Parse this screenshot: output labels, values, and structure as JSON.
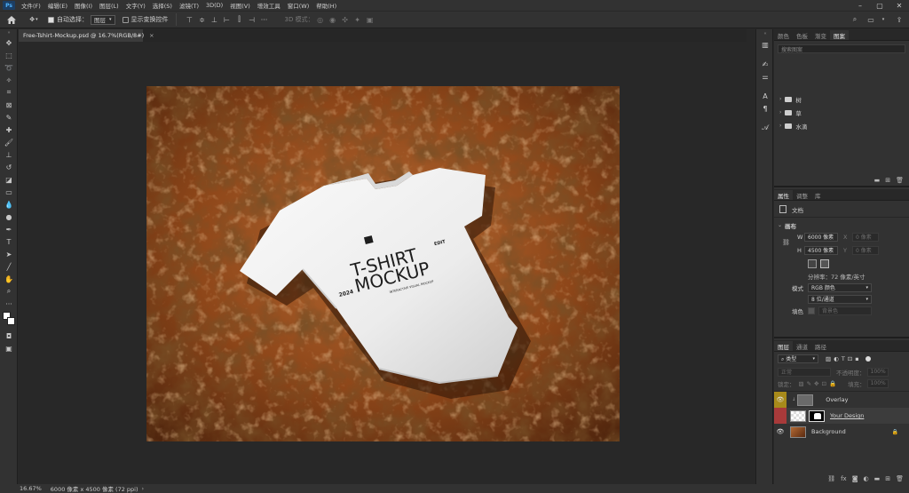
{
  "menu": [
    "文件(F)",
    "编辑(E)",
    "图像(I)",
    "图层(L)",
    "文字(Y)",
    "选择(S)",
    "滤镜(T)",
    "3D(D)",
    "视图(V)",
    "增效工具",
    "窗口(W)",
    "帮助(H)"
  ],
  "options": {
    "auto_select_label": "自动选择：",
    "auto_select_value": "图层",
    "show_transform_label": "显示变换控件",
    "mode_3d_label": "3D 模式："
  },
  "document": {
    "tab_title": "Free-Tshirt-Mockup.psd @ 16.7%(RGB/8#)",
    "close_glyph": "×"
  },
  "artwork": {
    "shirt_text_main": "T-SHIRT",
    "shirt_text_sub": "MOCKUP",
    "shirt_year": "2024",
    "shirt_edit": "EDIT",
    "shirt_small": "INTERACTIVE VISUAL MOCKUP",
    "colors": {
      "sand": "#9a4e1f",
      "sand_light": "#c27a3e",
      "sand_dark": "#3a1a0a",
      "shirt": "#f1f1f1"
    }
  },
  "status": {
    "zoom": "16.67%",
    "doc_size": "6000 像素 x 4500 像素 (72 ppi)",
    "arrow": "›"
  },
  "libraries_panel": {
    "tabs": [
      "颜色",
      "色板",
      "渐变",
      "图案"
    ],
    "search_placeholder": "搜索图案",
    "groups": [
      "树",
      "草",
      "水滴"
    ]
  },
  "properties_panel": {
    "tabs": [
      "属性",
      "调整",
      "库"
    ],
    "doc_label": "文档",
    "canvas_label": "画布",
    "width_label": "W",
    "width_value": "6000 像素",
    "x_label": "X",
    "x_placeholder": "0 像素",
    "height_label": "H",
    "height_value": "4500 像素",
    "y_label": "Y",
    "y_placeholder": "0 像素",
    "resolution": "分辨率：72 像素/英寸",
    "mode_label": "模式",
    "mode_value": "RGB 颜色",
    "depth_value": "8 位/通道",
    "fill_label": "填色",
    "fill_value": "背景色"
  },
  "layers_panel": {
    "tabs": [
      "图层",
      "通道",
      "路径"
    ],
    "filter_type": "类型",
    "blend_mode": "正常",
    "opacity_label": "不透明度：",
    "opacity_value": "100%",
    "lock_label": "锁定：",
    "fill_label": "填充：",
    "fill_value": "100%",
    "layers": [
      {
        "name": "Overlay",
        "eye_color": "#a88a1a"
      },
      {
        "name": "Your Design",
        "eye_color": "#a83a3a"
      },
      {
        "name": "Background",
        "eye_color": "#323232"
      }
    ]
  }
}
